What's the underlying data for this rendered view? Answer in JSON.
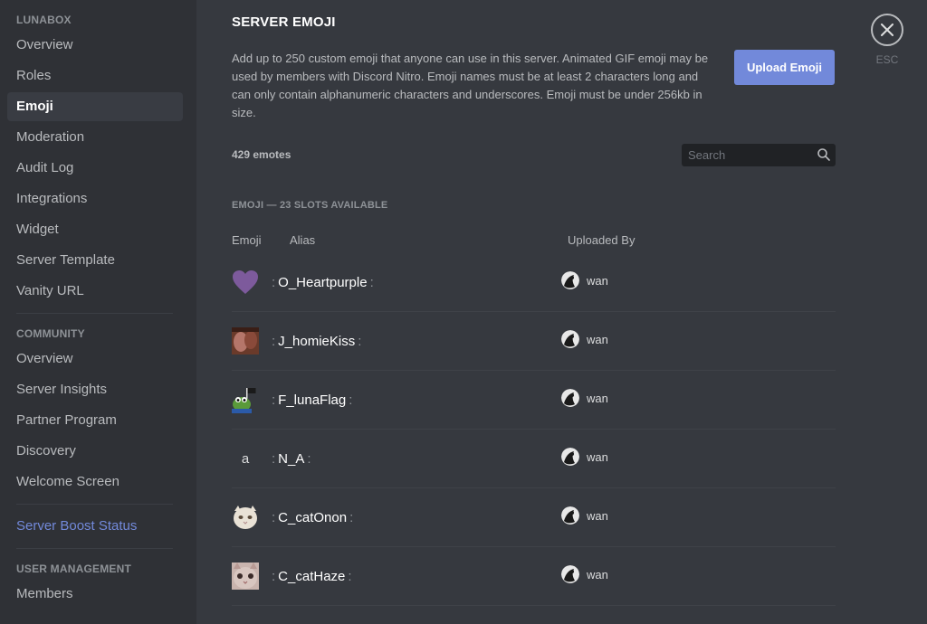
{
  "sidebar": {
    "server_header": "LUNABOX",
    "server_items": [
      {
        "label": "Overview"
      },
      {
        "label": "Roles"
      },
      {
        "label": "Emoji",
        "active": true
      },
      {
        "label": "Moderation"
      },
      {
        "label": "Audit Log"
      },
      {
        "label": "Integrations"
      },
      {
        "label": "Widget"
      },
      {
        "label": "Server Template"
      },
      {
        "label": "Vanity URL"
      }
    ],
    "community_header": "COMMUNITY",
    "community_items": [
      {
        "label": "Overview"
      },
      {
        "label": "Server Insights"
      },
      {
        "label": "Partner Program"
      },
      {
        "label": "Discovery"
      },
      {
        "label": "Welcome Screen"
      }
    ],
    "boost_label": "Server Boost Status",
    "user_mgmt_header": "USER MANAGEMENT",
    "user_mgmt_items": [
      {
        "label": "Members"
      }
    ]
  },
  "main": {
    "title": "SERVER EMOJI",
    "description": "Add up to 250 custom emoji that anyone can use in this server. Animated GIF emoji may be used by members with Discord Nitro. Emoji names must be at least 2 characters long and can only contain alphanumeric characters and underscores. Emoji must be under 256kb in size.",
    "upload_label": "Upload Emoji",
    "esc_label": "ESC",
    "count_label": "429 emotes",
    "search_placeholder": "Search",
    "slots_label": "EMOJI — 23 SLOTS AVAILABLE",
    "columns": {
      "emoji": "Emoji",
      "alias": "Alias",
      "uploaded_by": "Uploaded By"
    }
  },
  "emojis": [
    {
      "alias": "O_Heartpurple",
      "icon": "purple-heart",
      "uploader": "wan"
    },
    {
      "alias": "J_homieKiss",
      "icon": "kiss-image",
      "uploader": "wan"
    },
    {
      "alias": "F_lunaFlag",
      "icon": "frog-flag-image",
      "uploader": "wan"
    },
    {
      "alias": "N_A",
      "icon": "letter-a",
      "icon_text": "a",
      "uploader": "wan"
    },
    {
      "alias": "C_catOnon",
      "icon": "cat-image",
      "uploader": "wan"
    },
    {
      "alias": "C_catHaze",
      "icon": "cat-haze-image",
      "uploader": "wan"
    }
  ],
  "colors": {
    "accent": "#7289da",
    "sidebar_bg": "#2f3136",
    "main_bg": "#36393f",
    "heart": "#8a5ca8"
  }
}
